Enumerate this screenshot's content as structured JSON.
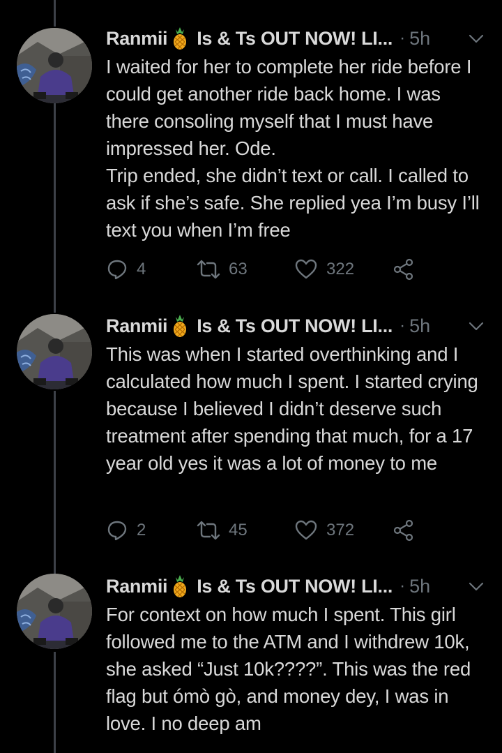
{
  "colors": {
    "background": "#000000",
    "text": "#d9d9d9",
    "muted": "#6e767d",
    "thread_line": "#3d4148"
  },
  "tweets": [
    {
      "display_name": "Ranmii",
      "name_emoji": "pineapple-emoji",
      "handle_truncated": "Is & Ts OUT NOW! LI...",
      "time": "5h",
      "text": "I waited for her to complete her ride before I could get another ride back home. I was there consoling myself that I must have impressed her. Ode.\nTrip ended, she didn’t text or call. I called to ask if she’s safe. She replied yea I’m busy I’ll text you when I’m free",
      "replies": "4",
      "retweets": "63",
      "likes": "322"
    },
    {
      "display_name": "Ranmii",
      "name_emoji": "pineapple-emoji",
      "handle_truncated": "Is & Ts OUT NOW! LI...",
      "time": "5h",
      "text": "This was when I started overthinking and I calculated how much I spent. I started crying because I believed I didn’t deserve such treatment after spending that much, for a 17 year old yes it was a lot of money to me",
      "replies": "2",
      "retweets": "45",
      "likes": "372"
    },
    {
      "display_name": "Ranmii",
      "name_emoji": "pineapple-emoji",
      "handle_truncated": "Is & Ts OUT NOW! LI...",
      "time": "5h",
      "text": "For context on how much I spent. This girl followed me to the ATM and I withdrew 10k, she asked “Just 10k????”. This was the red flag but ómò gò, and money dey, I was in love. I no deep am"
    }
  ]
}
